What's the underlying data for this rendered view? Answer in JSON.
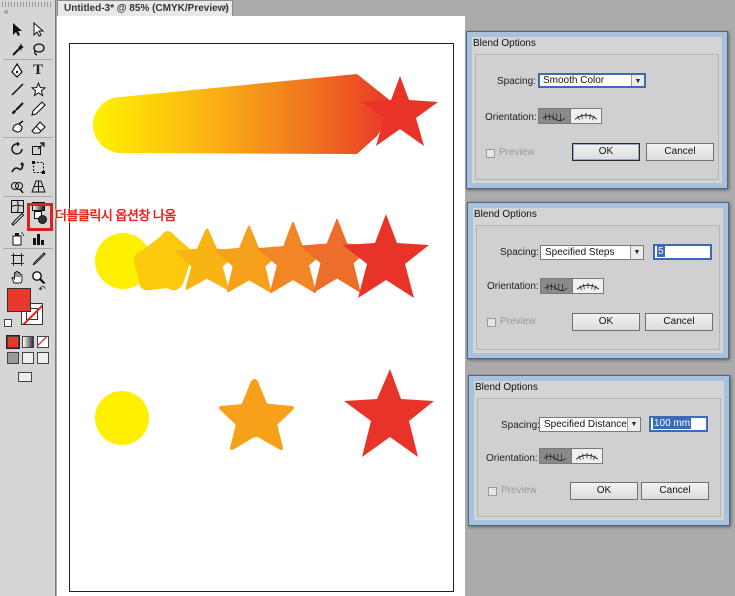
{
  "document_tab": {
    "title": "Untitled-3* @ 85% (CMYK/Preview)",
    "close": "×"
  },
  "annotation": "더블클릭시 옵션창 나옴",
  "toolbar": {
    "collapse": "«",
    "fill_color": "#e8382e",
    "tools": [
      "selection-tool",
      "direct-selection-tool",
      "magic-wand-tool",
      "lasso-tool",
      "pen-tool",
      "type-tool",
      "line-segment-tool",
      "star-tool",
      "paintbrush-tool",
      "pencil-tool",
      "blob-brush-tool",
      "eraser-tool",
      "rotate-tool",
      "scale-tool",
      "warp-tool",
      "free-transform-tool",
      "shape-builder-tool",
      "perspective-grid-tool",
      "mesh-tool",
      "gradient-tool",
      "eyedropper-tool",
      "blend-tool",
      "symbol-sprayer-tool",
      "column-graph-tool",
      "artboard-tool",
      "slice-tool",
      "hand-tool",
      "zoom-tool"
    ]
  },
  "dialogs": [
    {
      "title": "Blend Options",
      "spacing_label": "Spacing:",
      "spacing_value": "Smooth Color",
      "spacing_value_input": "",
      "orientation_label": "Orientation:",
      "preview_label": "Preview",
      "ok_label": "OK",
      "cancel_label": "Cancel"
    },
    {
      "title": "Blend Options",
      "spacing_label": "Spacing:",
      "spacing_value": "Specified Steps",
      "spacing_value_input": "5",
      "orientation_label": "Orientation:",
      "preview_label": "Preview",
      "ok_label": "OK",
      "cancel_label": "Cancel"
    },
    {
      "title": "Blend Options",
      "spacing_label": "Spacing:",
      "spacing_value": "Specified Distance",
      "spacing_value_input": "100 mm",
      "orientation_label": "Orientation:",
      "preview_label": "Preview",
      "ok_label": "OK",
      "cancel_label": "Cancel"
    }
  ],
  "artwork": {
    "start_color": "#ffee00",
    "end_color": "#e83328",
    "steps_row_colors": [
      "#fff000",
      "#fccc0a",
      "#f9b412",
      "#f6a01b",
      "#f28524",
      "#ed6d2a",
      "#e83328"
    ],
    "distance_row_colors": [
      "#fff000",
      "#f7a11a",
      "#e83328"
    ]
  }
}
